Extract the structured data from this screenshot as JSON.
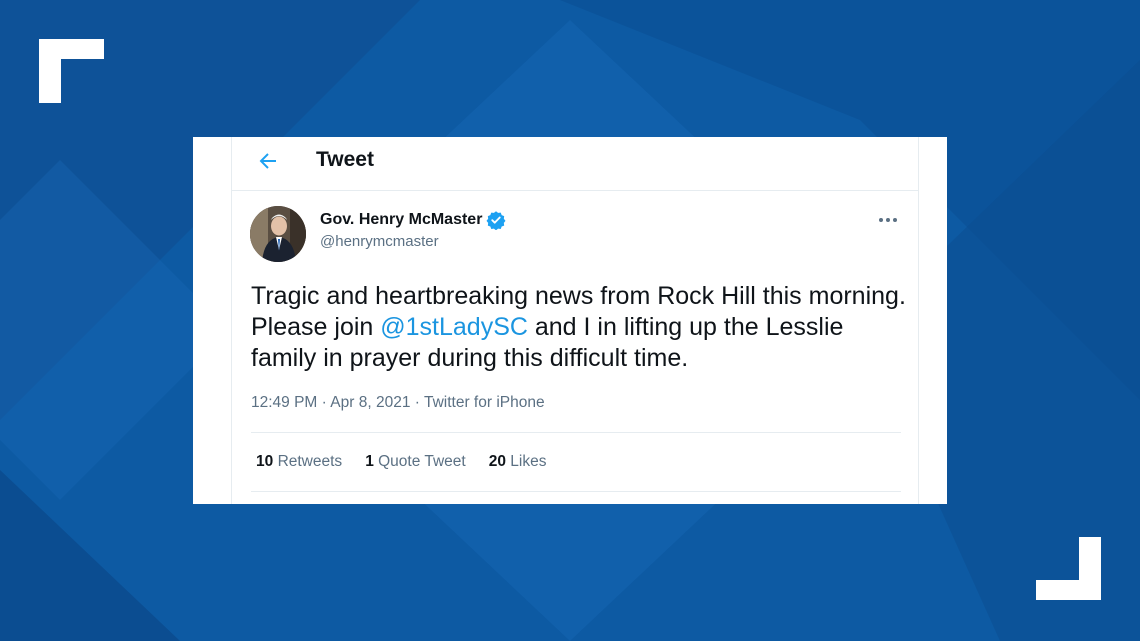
{
  "header": {
    "title": "Tweet"
  },
  "author": {
    "name": "Gov. Henry McMaster",
    "handle": "@henrymcmaster"
  },
  "tweet": {
    "text_before": "Tragic and heartbreaking news from Rock Hill this morning. Please join ",
    "mention": "@1stLadySC",
    "text_after": " and I in lifting up the Lesslie family in prayer during this difficult time.",
    "time": "12:49 PM",
    "date": "Apr 8, 2021",
    "source": "Twitter for iPhone",
    "dot": "·"
  },
  "stats": {
    "retweets_count": "10",
    "retweets_label": "Retweets",
    "quotes_count": "1",
    "quotes_label": "Quote Tweet",
    "likes_count": "20",
    "likes_label": "Likes"
  },
  "colors": {
    "background": "#0d5aa3",
    "accent": "#1b95e0",
    "text": "#0f1419",
    "muted": "#5b7083"
  },
  "icons": [
    "back-arrow-icon",
    "verified-badge-icon",
    "more-options-icon"
  ]
}
